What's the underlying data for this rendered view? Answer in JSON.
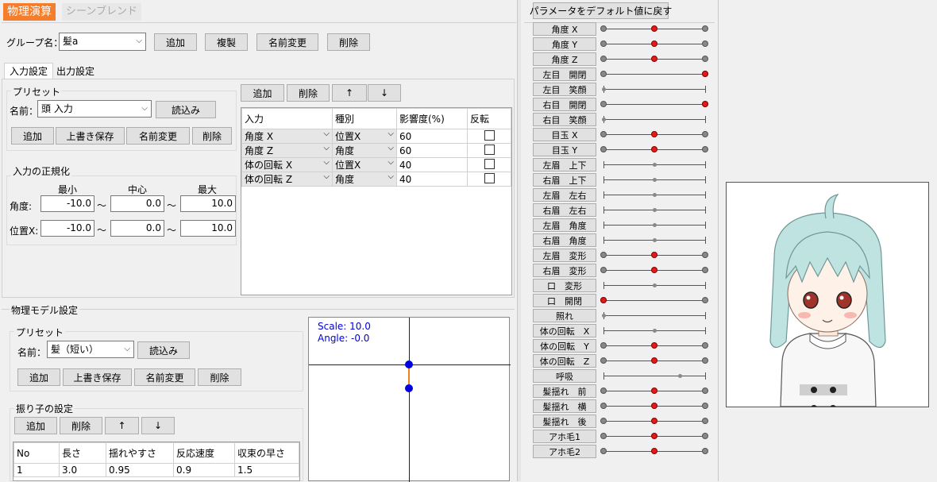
{
  "tabs": {
    "active": "物理演算",
    "inactive": "シーンブレンド"
  },
  "group": {
    "label": "グループ名：",
    "value": "髪a",
    "buttons": [
      "追加",
      "複製",
      "名前変更",
      "削除"
    ]
  },
  "io_tabs": [
    "入力設定",
    "出力設定"
  ],
  "preset1": {
    "title": "プリセット",
    "name_label": "名前：",
    "name_value": "頭 入力",
    "load": "読込み",
    "buttons": [
      "追加",
      "上書き保存",
      "名前変更",
      "削除"
    ]
  },
  "normalize": {
    "title": "入力の正規化",
    "headers": [
      "最小",
      "中心",
      "最大"
    ],
    "rows": [
      {
        "label": "角度:",
        "min": "-10.0",
        "center": "0.0",
        "max": "10.0"
      },
      {
        "label": "位置X:",
        "min": "-10.0",
        "center": "0.0",
        "max": "10.0"
      }
    ],
    "tilde": "～"
  },
  "input_table": {
    "buttons": [
      "追加",
      "削除",
      "↑",
      "↓"
    ],
    "headers": [
      "入力",
      "種別",
      "影響度(%)",
      "反転"
    ],
    "rows": [
      {
        "input": "角度 X",
        "kind": "位置X",
        "weight": "60"
      },
      {
        "input": "角度 Z",
        "kind": "角度",
        "weight": "60"
      },
      {
        "input": "体の回転 X",
        "kind": "位置X",
        "weight": "40"
      },
      {
        "input": "体の回転 Z",
        "kind": "角度",
        "weight": "40"
      }
    ]
  },
  "model": {
    "title": "物理モデル設定",
    "preset_title": "プリセット",
    "name_label": "名前：",
    "name_value": "髪（短い）",
    "load": "読込み",
    "buttons": [
      "追加",
      "上書き保存",
      "名前変更",
      "削除"
    ],
    "pendulum_title": "振り子の設定",
    "pendulum_buttons": [
      "追加",
      "削除",
      "↑",
      "↓"
    ],
    "table_headers": [
      "No",
      "長さ",
      "揺れやすさ",
      "反応速度",
      "収束の早さ"
    ],
    "table_rows": [
      [
        "1",
        "3.0",
        "0.95",
        "0.9",
        "1.5"
      ]
    ],
    "scale_text": "Scale: 10.0",
    "angle_text": "Angle: -0.0"
  },
  "params": {
    "reset_button": "パラメータをデフォルト値に戻す",
    "items": [
      {
        "label": "角度 X",
        "value": 0.5,
        "ends": true
      },
      {
        "label": "角度 Y",
        "value": 0.5,
        "ends": true
      },
      {
        "label": "角度 Z",
        "value": 0.5,
        "ends": true
      },
      {
        "label": "左目　開閉",
        "value": 1.0,
        "ends": true
      },
      {
        "label": "左目　笑顔",
        "value": 0.0,
        "ends": false
      },
      {
        "label": "右目　開閉",
        "value": 1.0,
        "ends": true
      },
      {
        "label": "右目　笑顔",
        "value": 0.0,
        "ends": false
      },
      {
        "label": "目玉 X",
        "value": 0.5,
        "ends": true
      },
      {
        "label": "目玉 Y",
        "value": 0.5,
        "ends": true
      },
      {
        "label": "左眉　上下",
        "value": 0.5,
        "ends": false
      },
      {
        "label": "右眉　上下",
        "value": 0.5,
        "ends": false
      },
      {
        "label": "左眉　左右",
        "value": 0.5,
        "ends": false
      },
      {
        "label": "右眉　左右",
        "value": 0.5,
        "ends": false
      },
      {
        "label": "左眉　角度",
        "value": 0.5,
        "ends": false
      },
      {
        "label": "右眉　角度",
        "value": 0.5,
        "ends": false
      },
      {
        "label": "左眉　変形",
        "value": 0.5,
        "ends": true
      },
      {
        "label": "右眉　変形",
        "value": 0.5,
        "ends": true
      },
      {
        "label": "口　変形",
        "value": 0.5,
        "ends": false
      },
      {
        "label": "口　開閉",
        "value": 0.0,
        "ends": true
      },
      {
        "label": "照れ",
        "value": 0.0,
        "ends": false
      },
      {
        "label": "体の回転　X",
        "value": 0.5,
        "ends": false
      },
      {
        "label": "体の回転　Y",
        "value": 0.5,
        "ends": true
      },
      {
        "label": "体の回転　Z",
        "value": 0.5,
        "ends": true
      },
      {
        "label": "呼吸",
        "value": 0.75,
        "ends": false
      },
      {
        "label": "髪揺れ　前",
        "value": 0.5,
        "ends": true
      },
      {
        "label": "髪揺れ　横",
        "value": 0.5,
        "ends": true
      },
      {
        "label": "髪揺れ　後",
        "value": 0.5,
        "ends": true
      },
      {
        "label": "アホ毛1",
        "value": 0.5,
        "ends": true
      },
      {
        "label": "アホ毛2",
        "value": 0.5,
        "ends": true
      }
    ]
  },
  "colors": {
    "accent_tab": "#f47e2c",
    "knob_red": "#e11b1b",
    "axis_blue": "#0000e0",
    "link_orange": "#f08020"
  }
}
